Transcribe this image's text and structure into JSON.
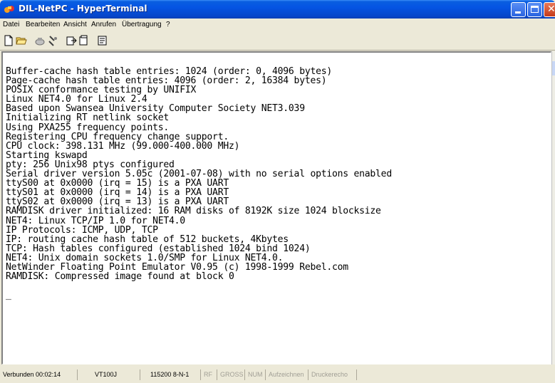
{
  "window": {
    "title": "DIL-NetPC - HyperTerminal",
    "accent": "#0554e3"
  },
  "menu": {
    "items": [
      "Datei",
      "Bearbeiten",
      "Ansicht",
      "Anrufen",
      "Übertragung",
      "?"
    ]
  },
  "toolbar": {
    "icons": [
      "new-icon",
      "open-icon",
      "connect-icon",
      "disconnect-icon",
      "send-icon",
      "receive-icon",
      "properties-icon"
    ]
  },
  "terminal": {
    "lines": [
      "Buffer-cache hash table entries: 1024 (order: 0, 4096 bytes)",
      "Page-cache hash table entries: 4096 (order: 2, 16384 bytes)",
      "POSIX conformance testing by UNIFIX",
      "Linux NET4.0 for Linux 2.4",
      "Based upon Swansea University Computer Society NET3.039",
      "Initializing RT netlink socket",
      "Using PXA255 frequency points.",
      "Registering CPU frequency change support.",
      "CPU clock: 398.131 MHz (99.000-400.000 MHz)",
      "Starting kswapd",
      "pty: 256 Unix98 ptys configured",
      "Serial driver version 5.05c (2001-07-08) with no serial options enabled",
      "ttyS00 at 0x0000 (irq = 15) is a PXA UART",
      "ttyS01 at 0x0000 (irq = 14) is a PXA UART",
      "ttyS02 at 0x0000 (irq = 13) is a PXA UART",
      "RAMDISK driver initialized: 16 RAM disks of 8192K size 1024 blocksize",
      "NET4: Linux TCP/IP 1.0 for NET4.0",
      "IP Protocols: ICMP, UDP, TCP",
      "IP: routing cache hash table of 512 buckets, 4Kbytes",
      "TCP: Hash tables configured (established 1024 bind 1024)",
      "NET4: Unix domain sockets 1.0/SMP for Linux NET4.0.",
      "NetWinder Floating Point Emulator V0.95 (c) 1998-1999 Rebel.com",
      "RAMDISK: Compressed image found at block 0",
      ""
    ],
    "cursor": "_"
  },
  "status": {
    "connection": "Verbunden 00:02:14",
    "emulation": "VT100J",
    "port_settings": "115200 8-N-1",
    "scroll": "RF",
    "caps": "GROSS",
    "num": "NUM",
    "capture": "Aufzeichnen",
    "print_echo": "Druckerecho"
  }
}
